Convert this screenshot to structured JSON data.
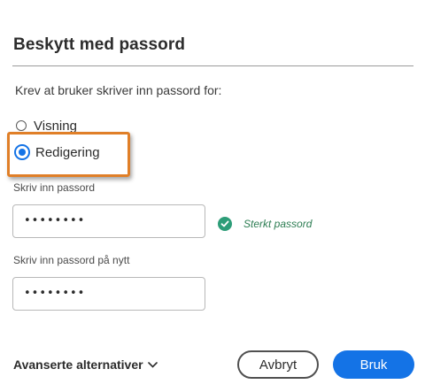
{
  "dialog": {
    "title": "Beskytt med passord",
    "prompt": "Krev at bruker skriver inn passord for:",
    "options": [
      {
        "label": "Visning",
        "selected": false
      },
      {
        "label": "Redigering",
        "selected": true
      }
    ],
    "password_label": "Skriv inn passord",
    "password_value": "••••••••",
    "strength_text": "Sterkt passord",
    "confirm_label": "Skriv inn passord på nytt",
    "confirm_value": "••••••••",
    "advanced_label": "Avanserte alternativer",
    "cancel_label": "Avbryt",
    "apply_label": "Bruk"
  },
  "colors": {
    "accent": "#1473e6",
    "highlight": "#e07f28",
    "success": "#2d9d78"
  },
  "icons": [
    "check-circle-icon",
    "chevron-down-icon"
  ]
}
